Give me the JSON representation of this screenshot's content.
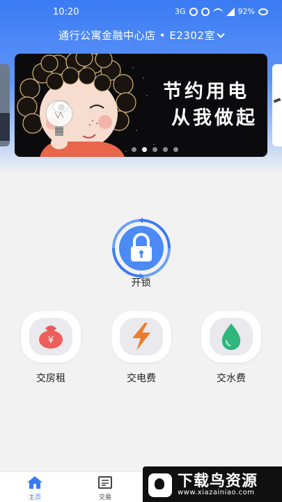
{
  "status_bar": {
    "time": "10:20",
    "network": "3G",
    "battery": "92%",
    "icons": [
      "alarm-icon",
      "mute-icon",
      "wifi-icon",
      "signal-icon",
      "eye-icon"
    ]
  },
  "header": {
    "store_name": "通行公寓金融中心店 • E2302室",
    "dropdown_icon": "chevron-down-icon",
    "gradient_top": "#3a7bf4"
  },
  "banner": {
    "line1": "节约用电",
    "line2": "从我做起",
    "dots_count": 5,
    "active_dot": 1
  },
  "unlock": {
    "label": "开锁",
    "icon": "padlock-icon",
    "color": "#3a7bf4"
  },
  "services": [
    {
      "label": "交房租",
      "icon": "money-bag-icon",
      "color": "#e85a5a",
      "glyph": "¥"
    },
    {
      "label": "交电费",
      "icon": "lightning-icon",
      "color": "#f07a2a"
    },
    {
      "label": "交水费",
      "icon": "water-drop-icon",
      "color": "#2fb67c"
    }
  ],
  "tabbar": {
    "items": [
      {
        "label": "主页",
        "icon": "home-icon",
        "active": true
      },
      {
        "label": "交易",
        "icon": "document-icon",
        "active": false
      }
    ],
    "active_color": "#3a7bf4"
  },
  "watermark": {
    "title": "下载鸟资源",
    "url": "www.xiazainiao.com"
  }
}
